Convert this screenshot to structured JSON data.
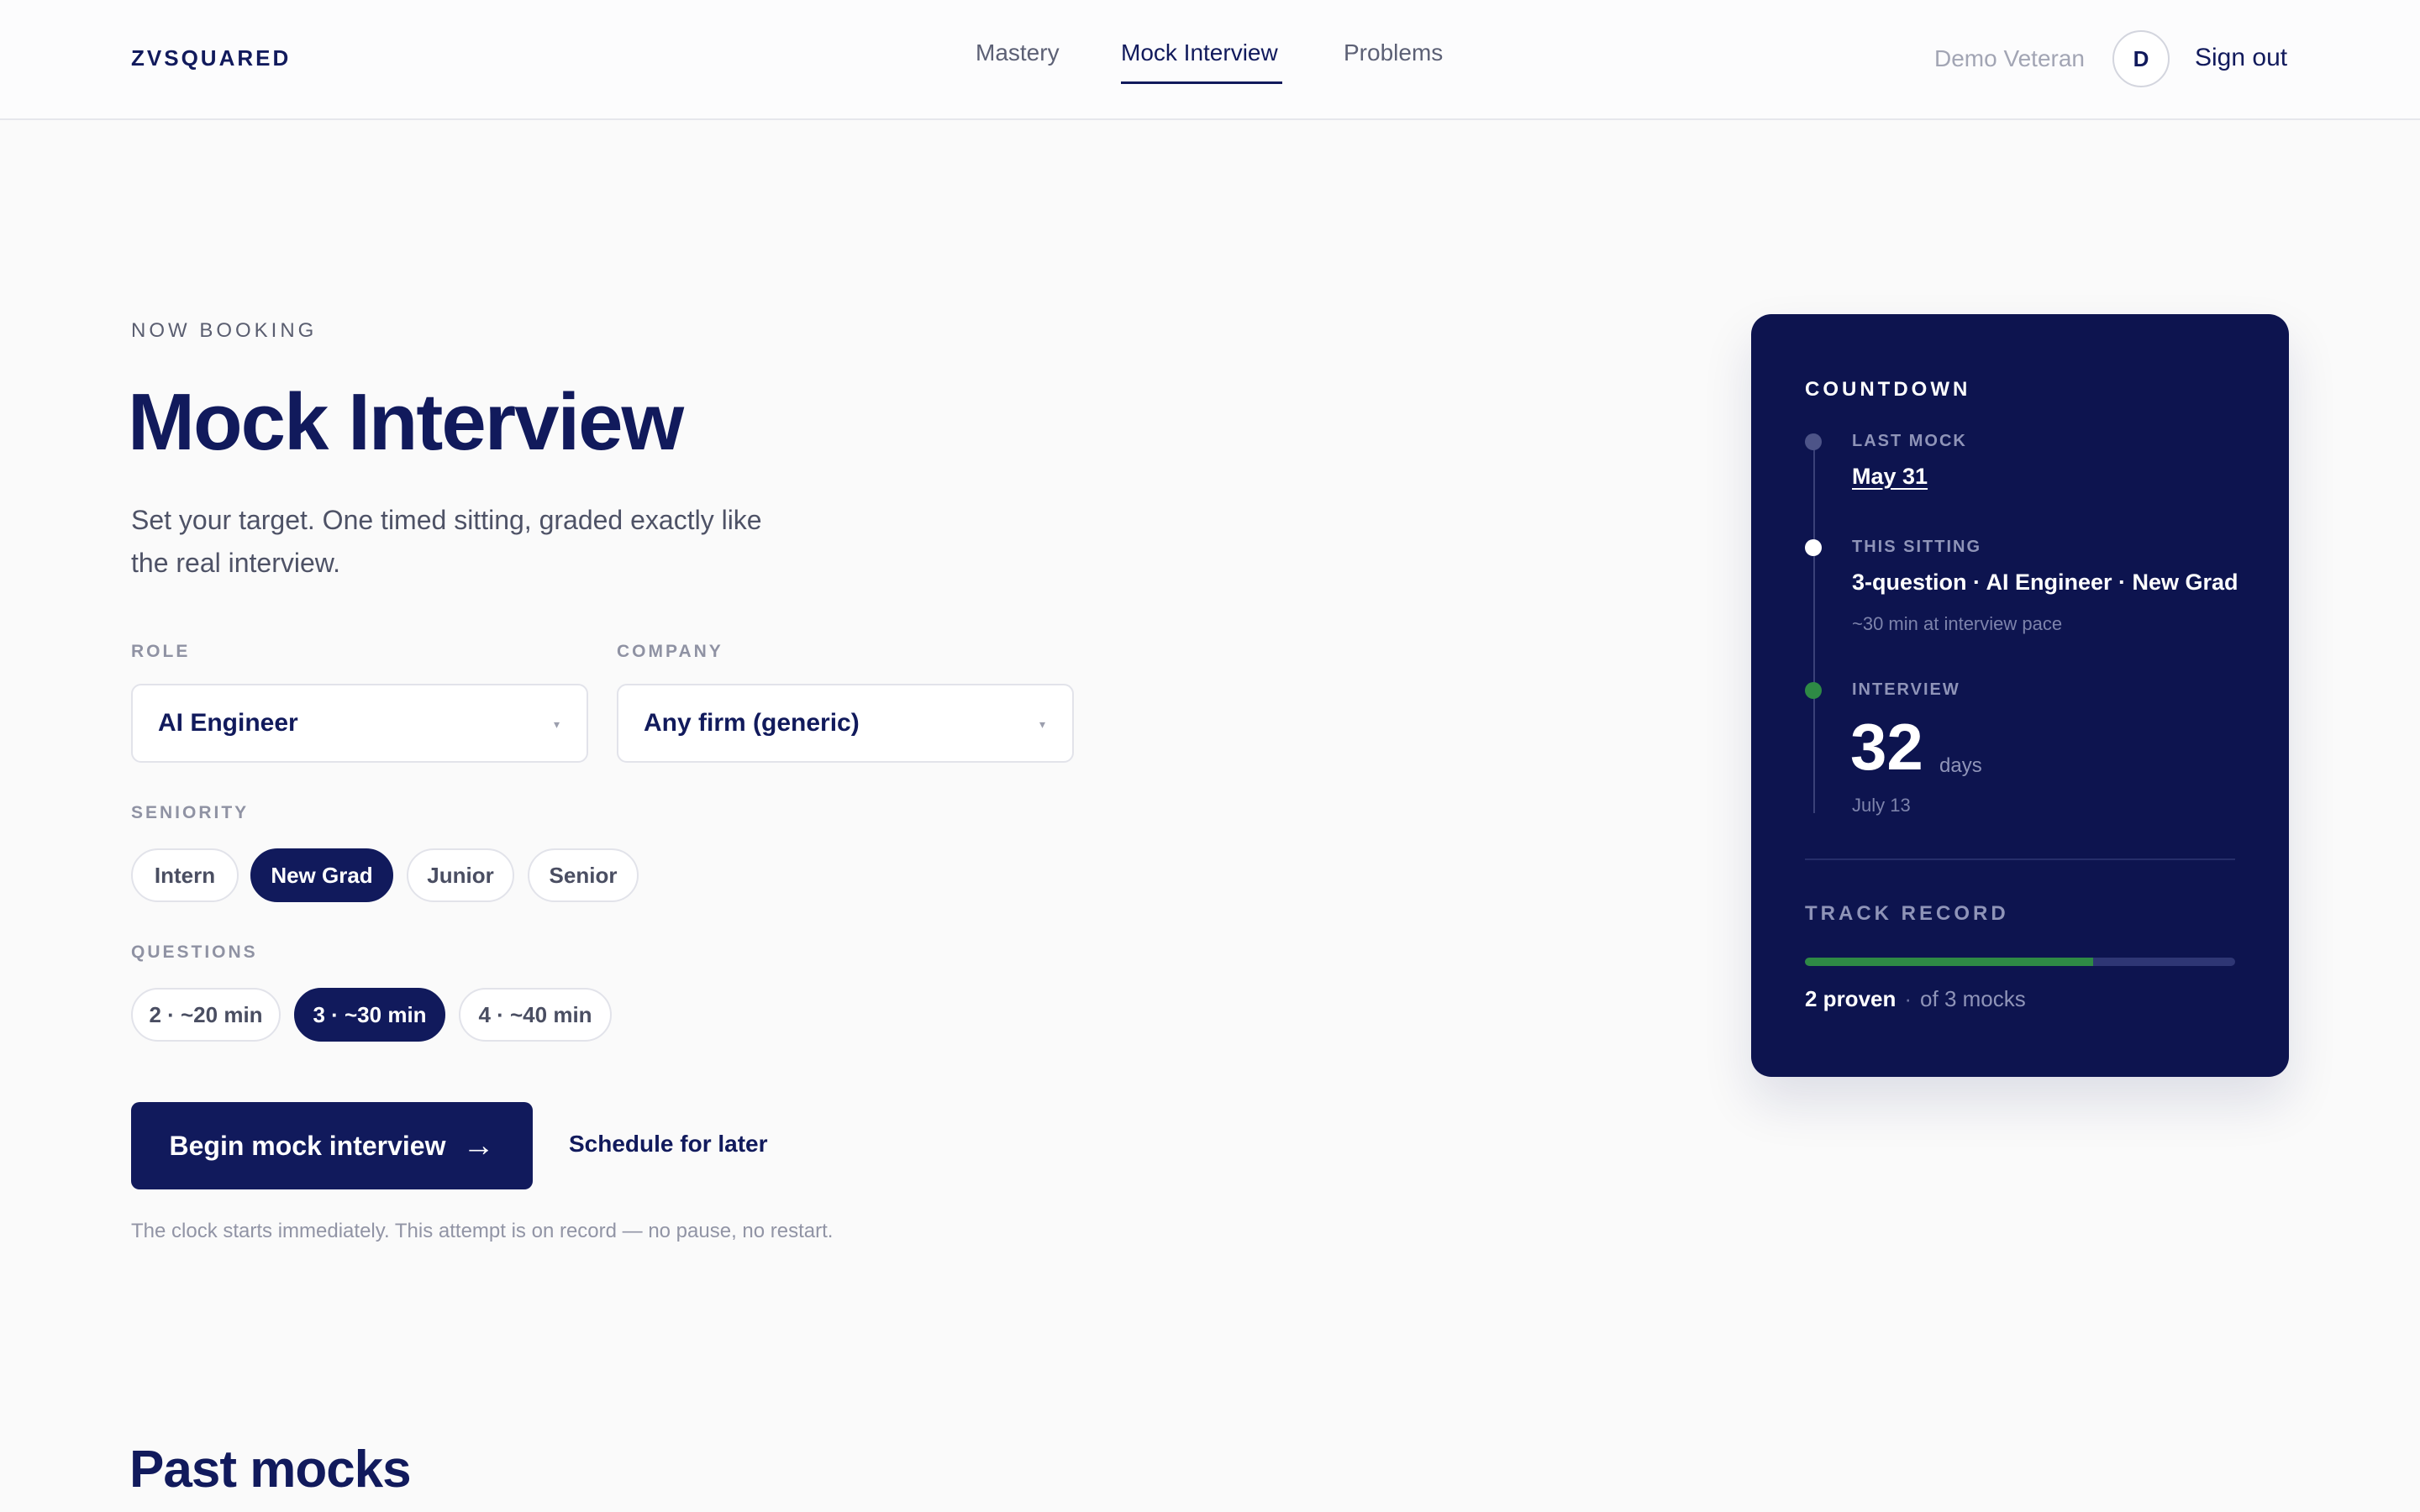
{
  "header": {
    "brand": "ZVSQUARED",
    "nav": [
      {
        "label": "Mastery",
        "active": false
      },
      {
        "label": "Mock Interview",
        "active": true
      },
      {
        "label": "Problems",
        "active": false
      }
    ],
    "user_name": "Demo Veteran",
    "avatar_initial": "D",
    "sign_out": "Sign out"
  },
  "hero": {
    "eyebrow": "NOW BOOKING",
    "title": "Mock Interview",
    "subtitle_line1": "Set your target. One timed sitting, graded exactly like",
    "subtitle_line2": "the real interview."
  },
  "form": {
    "role": {
      "label": "ROLE",
      "value": "AI Engineer"
    },
    "company": {
      "label": "COMPANY",
      "value": "Any firm (generic)"
    },
    "seniority": {
      "label": "SENIORITY",
      "options": [
        "Intern",
        "New Grad",
        "Junior",
        "Senior"
      ],
      "selected": "New Grad"
    },
    "questions": {
      "label": "QUESTIONS",
      "options": [
        "2 · ~20 min",
        "3 · ~30 min",
        "4 · ~40 min"
      ],
      "selected": "3 · ~30 min"
    }
  },
  "actions": {
    "begin": "Begin mock interview",
    "begin_arrow": "→",
    "schedule": "Schedule for later",
    "note": "The clock starts immediately. This attempt is on record — no pause, no restart."
  },
  "past_mocks": {
    "title": "Past mocks"
  },
  "countdown": {
    "title": "COUNTDOWN",
    "last_mock": {
      "label": "LAST MOCK",
      "value": "May 31"
    },
    "this_sitting": {
      "label": "THIS SITTING",
      "value": "3-question · AI Engineer · New Grad",
      "meta": "~30 min at interview pace"
    },
    "interview": {
      "label": "INTERVIEW",
      "days": "32",
      "days_unit": "days",
      "date": "July 13"
    },
    "track_record": {
      "title": "TRACK RECORD",
      "proven": "2 proven",
      "separator": "·",
      "of_total": "of 3 mocks",
      "progress": 0.67
    }
  },
  "colors": {
    "primary": "#111a5c",
    "card_bg": "#0d144f",
    "success": "#2e8a45",
    "page_bg": "#fafafa"
  }
}
